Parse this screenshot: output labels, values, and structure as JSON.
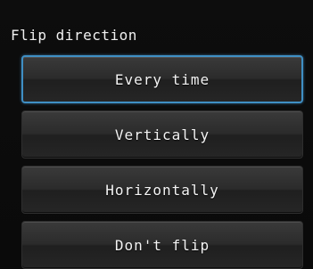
{
  "dialog": {
    "title": "Flip direction",
    "accent_color": "#3f8fc4",
    "options": [
      {
        "label": "Every time",
        "selected": true
      },
      {
        "label": "Vertically",
        "selected": false
      },
      {
        "label": "Horizontally",
        "selected": false
      },
      {
        "label": "Don't flip",
        "selected": false
      }
    ]
  }
}
